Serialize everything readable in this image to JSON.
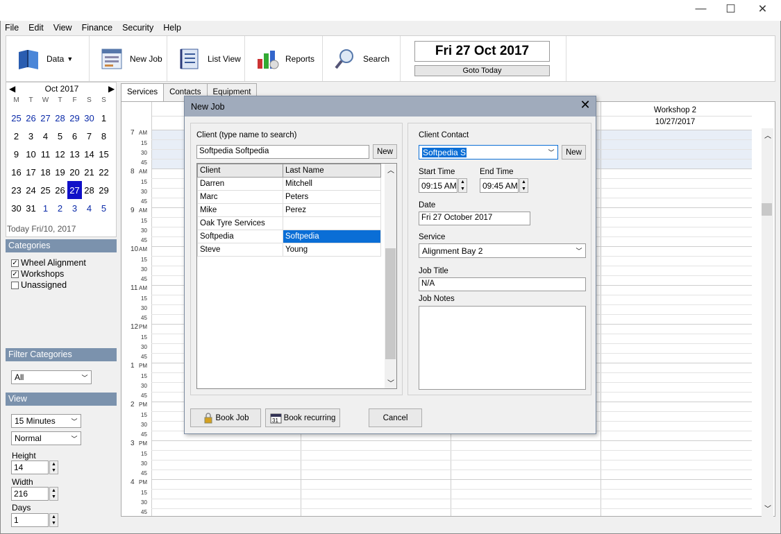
{
  "menu": [
    "File",
    "Edit",
    "View",
    "Finance",
    "Security",
    "Help"
  ],
  "window_controls": {
    "minimize": "—",
    "maximize": "☐",
    "close": "✕"
  },
  "toolbar": {
    "data_label": "Data",
    "newjob_label": "New Job",
    "listview_label": "List View",
    "reports_label": "Reports",
    "search_label": "Search",
    "date_display": "Fri 27 Oct 2017",
    "goto_today": "Goto Today"
  },
  "calendar": {
    "month_label": "Oct 2017",
    "prev": "◀",
    "next": "▶",
    "weekdays": [
      "M",
      "T",
      "W",
      "T",
      "F",
      "S",
      "S"
    ],
    "days": [
      {
        "d": "25",
        "o": true
      },
      {
        "d": "26",
        "o": true
      },
      {
        "d": "27",
        "o": true
      },
      {
        "d": "28",
        "o": true
      },
      {
        "d": "29",
        "o": true
      },
      {
        "d": "30",
        "o": true
      },
      {
        "d": "1",
        "o": false
      },
      {
        "d": "2"
      },
      {
        "d": "3"
      },
      {
        "d": "4"
      },
      {
        "d": "5"
      },
      {
        "d": "6"
      },
      {
        "d": "7"
      },
      {
        "d": "8"
      },
      {
        "d": "9"
      },
      {
        "d": "10"
      },
      {
        "d": "11"
      },
      {
        "d": "12"
      },
      {
        "d": "13"
      },
      {
        "d": "14"
      },
      {
        "d": "15"
      },
      {
        "d": "16"
      },
      {
        "d": "17"
      },
      {
        "d": "18"
      },
      {
        "d": "19"
      },
      {
        "d": "20"
      },
      {
        "d": "21"
      },
      {
        "d": "22"
      },
      {
        "d": "23"
      },
      {
        "d": "24"
      },
      {
        "d": "25"
      },
      {
        "d": "26"
      },
      {
        "d": "27",
        "sel": true
      },
      {
        "d": "28"
      },
      {
        "d": "29"
      },
      {
        "d": "30"
      },
      {
        "d": "31"
      },
      {
        "d": "1",
        "o": true
      },
      {
        "d": "2",
        "o": true
      },
      {
        "d": "3",
        "o": true
      },
      {
        "d": "4",
        "o": true
      },
      {
        "d": "5",
        "o": true
      }
    ],
    "today_label": "Today Fri/10, 2017"
  },
  "categories": {
    "header": "Categories",
    "items": [
      {
        "label": "Wheel Alignment",
        "checked": true
      },
      {
        "label": "Workshops",
        "checked": true
      },
      {
        "label": "Unassigned",
        "checked": false
      }
    ]
  },
  "filter": {
    "header": "Filter Categories",
    "value": "All"
  },
  "view": {
    "header": "View",
    "interval": "15 Minutes",
    "mode": "Normal",
    "height_label": "Height",
    "height_value": "14",
    "width_label": "Width",
    "width_value": "216",
    "days_label": "Days",
    "days_value": "1"
  },
  "tabs": [
    "Services",
    "Contacts",
    "Equipment"
  ],
  "schedule": {
    "column_header": "Workshop 2",
    "column_date": "10/27/2017",
    "hours": [
      {
        "h": "7",
        "ap": "AM"
      },
      {
        "h": "8",
        "ap": "AM"
      },
      {
        "h": "9",
        "ap": "AM"
      },
      {
        "h": "10",
        "ap": "AM"
      },
      {
        "h": "11",
        "ap": "AM"
      },
      {
        "h": "12",
        "ap": "PM"
      },
      {
        "h": "1",
        "ap": "PM"
      },
      {
        "h": "2",
        "ap": "PM"
      },
      {
        "h": "3",
        "ap": "PM"
      },
      {
        "h": "4",
        "ap": "PM"
      }
    ],
    "quarters": [
      "15",
      "30",
      "45"
    ]
  },
  "dialog": {
    "title": "New Job",
    "close": "✕",
    "client_label": "Client (type name to search)",
    "client_value": "Softpedia Softpedia",
    "new_label": "New",
    "table_headers": [
      "Client",
      "Last Name"
    ],
    "rows": [
      {
        "first": "Darren",
        "last": "Mitchell"
      },
      {
        "first": "Marc",
        "last": "Peters"
      },
      {
        "first": "Mike",
        "last": "Perez"
      },
      {
        "first": "Oak Tyre Services",
        "last": ""
      },
      {
        "first": "Softpedia",
        "last": "Softpedia",
        "hl": true
      },
      {
        "first": "Steve",
        "last": "Young"
      }
    ],
    "contact_label": "Client Contact",
    "contact_value": "Softpedia S",
    "start_label": "Start Time",
    "start_value": "09:15 AM",
    "end_label": "End Time",
    "end_value": "09:45 AM",
    "date_label": "Date",
    "date_value": "Fri 27 October 2017",
    "service_label": "Service",
    "service_value": "Alignment Bay 2",
    "jobtitle_label": "Job Title",
    "jobtitle_value": "N/A",
    "notes_label": "Job Notes",
    "book_job": "Book Job",
    "book_recurring": "Book recurring",
    "cancel": "Cancel"
  }
}
